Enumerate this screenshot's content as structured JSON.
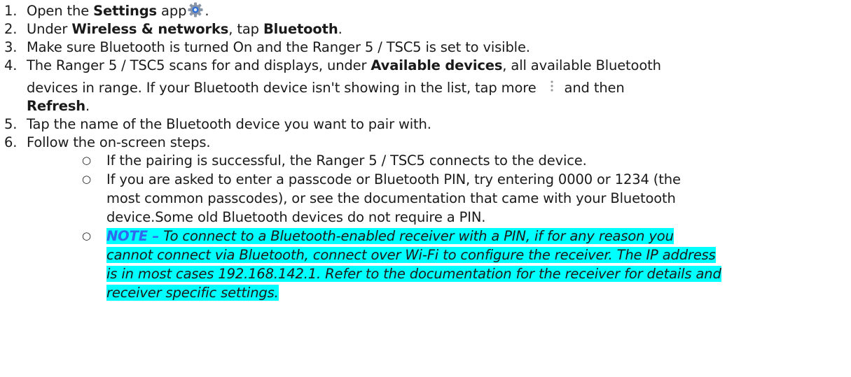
{
  "steps": [
    {
      "num": "1.",
      "pre": "Open the ",
      "bold": "Settings",
      "post": " app",
      "end": "."
    },
    {
      "num": "2.",
      "pre": "Under ",
      "bold1": "Wireless & networks",
      "mid": ", tap ",
      "bold2": "Bluetooth",
      "end": "."
    },
    {
      "num": "3.",
      "text": "Make sure Bluetooth is turned On and the Ranger 5 / TSC5 is set to visible."
    },
    {
      "num": "4.",
      "pre": "The Ranger 5 / TSC5 scans for and displays, under ",
      "bold": "Available devices",
      "post": ", all available Bluetooth",
      "line2_pre": "devices in range. If your Bluetooth device isn't showing in the list, tap more",
      "line2_post": "and then",
      "line3_bold": "Refresh",
      "line3_end": "."
    },
    {
      "num": "5.",
      "text": "Tap the name of the Bluetooth device you want to pair with."
    },
    {
      "num": "6.",
      "text": "Follow the on-screen steps."
    }
  ],
  "sub_items": [
    {
      "lines": [
        "If the pairing is successful, the Ranger 5 / TSC5 connects to the device."
      ]
    },
    {
      "lines": [
        "If you are asked to enter a passcode or Bluetooth PIN, try entering 0000 or 1234 (the",
        "most common passcodes), or see the documentation that came with your Bluetooth",
        "device.Some old Bluetooth devices do not require a PIN."
      ]
    }
  ],
  "note": {
    "label": "NOTE –",
    "line1": " To connect to a Bluetooth-enabled receiver with a PIN, if for any reason you",
    "lines": [
      "cannot connect via Bluetooth, connect over Wi-Fi to configure the receiver. The IP address",
      "is in most cases 192.168.142.1. Refer to the documentation for the receiver for details and",
      "receiver specific settings."
    ]
  },
  "bullet_glyph": "○",
  "icons": {
    "settings": "settings-gear-icon",
    "more": "more-vert-icon"
  },
  "colors": {
    "highlight": "#00ffff",
    "note_label": "#3366ee"
  }
}
